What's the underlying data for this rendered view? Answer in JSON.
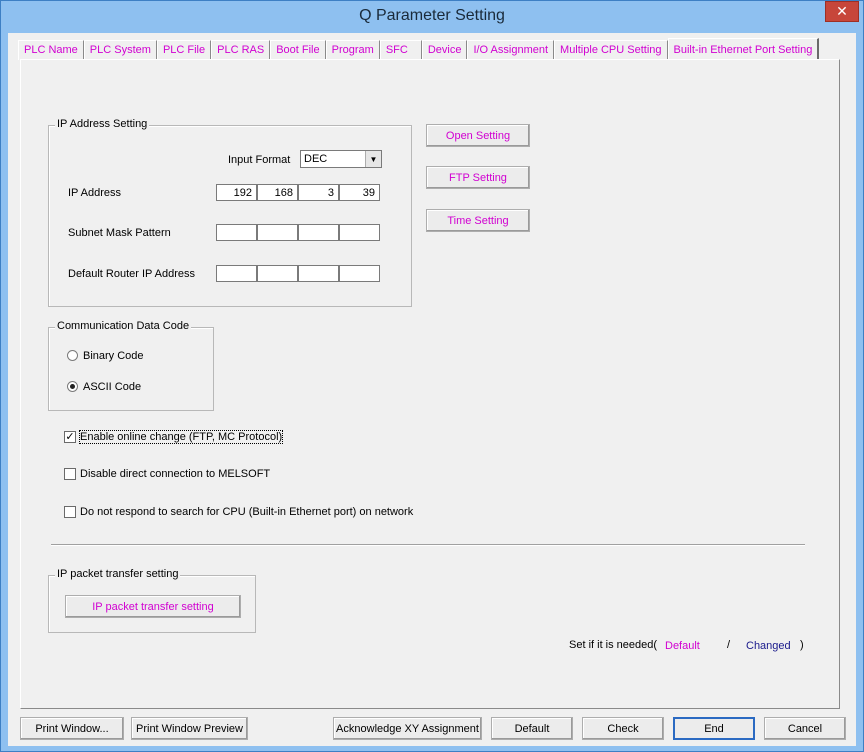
{
  "window": {
    "title": "Q Parameter Setting",
    "close_glyph": "✕"
  },
  "tabs": [
    {
      "label": "PLC Name"
    },
    {
      "label": "PLC System"
    },
    {
      "label": "PLC File"
    },
    {
      "label": "PLC RAS"
    },
    {
      "label": "Boot File"
    },
    {
      "label": "Program"
    },
    {
      "label": "SFC"
    },
    {
      "label": "Device"
    },
    {
      "label": "I/O Assignment"
    },
    {
      "label": "Multiple CPU Setting"
    },
    {
      "label": "Built-in Ethernet Port Setting",
      "active": true
    }
  ],
  "ip_address_setting": {
    "group_label": "IP Address Setting",
    "input_format_label": "Input Format",
    "input_format_value": "DEC",
    "ip_address_label": "IP Address",
    "ip_address": [
      "192",
      "168",
      "3",
      "39"
    ],
    "subnet_mask_label": "Subnet Mask Pattern",
    "subnet_mask": [
      "",
      "",
      "",
      ""
    ],
    "default_router_label": "Default Router IP Address",
    "default_router": [
      "",
      "",
      "",
      ""
    ]
  },
  "side_buttons": {
    "open_setting": "Open Setting",
    "ftp_setting": "FTP Setting",
    "time_setting": "Time Setting"
  },
  "communication_data_code": {
    "group_label": "Communication Data Code",
    "options": [
      {
        "label": "Binary Code",
        "checked": false
      },
      {
        "label": "ASCII Code",
        "checked": true
      }
    ]
  },
  "checkboxes": [
    {
      "label": "Enable online change (FTP, MC Protocol)",
      "checked": true,
      "mark": "✓"
    },
    {
      "label": "Disable direct connection to MELSOFT",
      "checked": false,
      "mark": ""
    },
    {
      "label": "Do not respond to search for CPU (Built-in Ethernet port) on network",
      "checked": false,
      "mark": ""
    }
  ],
  "ip_packet_transfer": {
    "group_label": "IP packet transfer setting",
    "button_label": "IP packet transfer setting"
  },
  "legend": {
    "prefix": "Set if it is needed(",
    "default_label": "Default",
    "slash": "/",
    "changed_label": "Changed",
    "suffix": ")"
  },
  "bottom_buttons": {
    "print_window": "Print Window...",
    "print_window_preview": "Print Window Preview",
    "acknowledge_xy": "Acknowledge XY Assignment",
    "default": "Default",
    "check": "Check",
    "end": "End",
    "cancel": "Cancel"
  },
  "colors": {
    "magenta_label": "#d100d1",
    "changed_label": "#1a1a8c",
    "focus_border": "#2b6ac2"
  }
}
